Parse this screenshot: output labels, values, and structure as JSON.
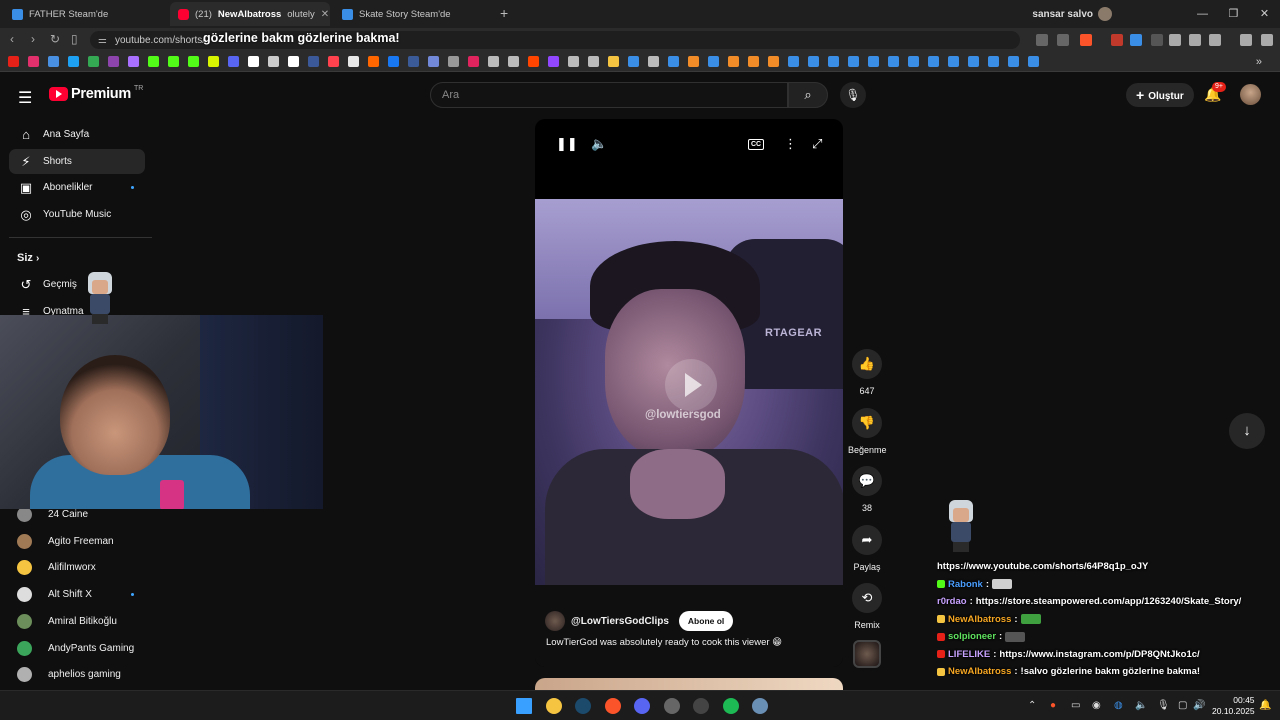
{
  "browser": {
    "tabs": [
      {
        "title": "FATHER Steam'de",
        "color": "#3a8ee6"
      },
      {
        "title": "(21) ",
        "color": "#ff0033"
      },
      {
        "title": "Skate Story Steam'de",
        "color": "#3a8ee6"
      }
    ],
    "tab_overlay_name": "NewAlbatross",
    "tab_overlay_tail": "olutely",
    "profile_name": "sansar salvo",
    "url": "youtube.com/shorts/",
    "chat_overlay": "gözlerine bakm gözlerine bakma!",
    "bookmark_colors": [
      "#e62117",
      "#e1306c",
      "#4a90e2",
      "#1da1f2",
      "#34a853",
      "#8e44ad",
      "#a970ff",
      "#53fc18",
      "#53fc18",
      "#53fc18",
      "#d7f500",
      "#5865f2",
      "#ffffff",
      "#cccccc",
      "#ffffff",
      "#3b5998",
      "#ff424d",
      "#e8e8e8",
      "#ff6600",
      "#1877f2",
      "#3a5a98",
      "#7289da",
      "#999999",
      "#e0245e",
      "#bbbbbb",
      "#bbbbbb",
      "#ff4500",
      "#9146ff",
      "#bbbbbb",
      "#bbbbbb",
      "#f5c542",
      "#3a8ee6",
      "#bbbbbb",
      "#3a8ee6",
      "#f28c28",
      "#3a8ee6",
      "#f28c28",
      "#f28c28",
      "#f28c28",
      "#3a8ee6",
      "#3a8ee6",
      "#3a8ee6",
      "#3a8ee6",
      "#3a8ee6",
      "#3a8ee6",
      "#3a8ee6",
      "#3a8ee6",
      "#3a8ee6",
      "#3a8ee6",
      "#3a8ee6",
      "#3a8ee6",
      "#3a8ee6"
    ]
  },
  "yt": {
    "logo_text": "Premium",
    "logo_sup": "TR",
    "search_placeholder": "Ara",
    "create_label": "Oluştur",
    "notif_count": "9+",
    "sidebar": [
      {
        "label": "Ana Sayfa",
        "icon": "⌂",
        "name": "home"
      },
      {
        "label": "Shorts",
        "icon": "⚡",
        "name": "shorts"
      },
      {
        "label": "Abonelikler",
        "icon": "▣",
        "name": "subscriptions"
      },
      {
        "label": "YouTube Music",
        "icon": "◎",
        "name": "youtube-music"
      }
    ],
    "you_label": "Siz",
    "history_label": "Geçmiş",
    "playlists_label": "Oynatma",
    "subscriptions": [
      {
        "label": "24 Caine",
        "color": "#888888",
        "dot": false
      },
      {
        "label": "Agito Freeman",
        "color": "#a07a55",
        "dot": false
      },
      {
        "label": "Alifilmworx",
        "color": "#f5c542",
        "dot": false
      },
      {
        "label": "Alt Shift X",
        "color": "#dddddd",
        "dot": true
      },
      {
        "label": "Amiral Bitikoğlu",
        "color": "#6b8e5a",
        "dot": false
      },
      {
        "label": "AndyPants Gaming",
        "color": "#3ba55c",
        "dot": false
      },
      {
        "label": "aphelios gaming",
        "color": "#b0b0b0",
        "dot": false
      }
    ],
    "short": {
      "channel": "@LowTiersGodClips",
      "subscribe_label": "Abone ol",
      "title": "LowTierGod was absolutely ready to cook this viewer 😁",
      "watermark": "@lowtiersgod",
      "chair_text": "RTAGEAR"
    },
    "actions": {
      "likes": "647",
      "dislike_label": "Beğenme",
      "comments": "38",
      "share_label": "Paylaş",
      "remix_label": "Remix"
    }
  },
  "chat": [
    {
      "user": "",
      "text": "https://www.youtube.com/shorts/64P8q1p_oJY",
      "user_color": "#ffffff",
      "badge": ""
    },
    {
      "user": "Rabonk",
      "text": "",
      "user_color": "#4a9eff",
      "badge": "#53fc18",
      "emote": "#cfcfcf"
    },
    {
      "user": "r0rdao",
      "text": "https://store.steampowered.com/app/1263240/Skate_Story/",
      "user_color": "#c8a2ff",
      "badge": ""
    },
    {
      "user": "NewAlbatross",
      "text": "",
      "user_color": "#f5a623",
      "badge": "#f5c542",
      "emote": "#3fa03f"
    },
    {
      "user": "solpioneer",
      "text": "",
      "user_color": "#5fe35f",
      "badge": "#e62117",
      "emote": "#555555"
    },
    {
      "user": "LIFELIKE",
      "text": "https://www.instagram.com/p/DP8QNtJko1c/",
      "user_color": "#c8a2ff",
      "badge": "#e62117"
    },
    {
      "user": "NewAlbatross",
      "text": "!salvo gözlerine bakm gözlerine bakma!",
      "user_color": "#f5a623",
      "badge": "#f5c542"
    }
  ],
  "taskbar": {
    "icons": [
      {
        "name": "windows-start-icon",
        "color": "#3aa0ff"
      },
      {
        "name": "file-explorer-icon",
        "color": "#f5c542"
      },
      {
        "name": "steam-icon",
        "color": "#1b4a6b"
      },
      {
        "name": "brave-icon",
        "color": "#fb542b"
      },
      {
        "name": "discord-icon",
        "color": "#5865f2"
      },
      {
        "name": "app-icon",
        "color": "#666666"
      },
      {
        "name": "obs-icon",
        "color": "#444444"
      },
      {
        "name": "spotify-icon",
        "color": "#1db954"
      },
      {
        "name": "game-icon",
        "color": "#6a8fb5"
      }
    ],
    "time": "00:45",
    "date": "20.10.2025"
  }
}
